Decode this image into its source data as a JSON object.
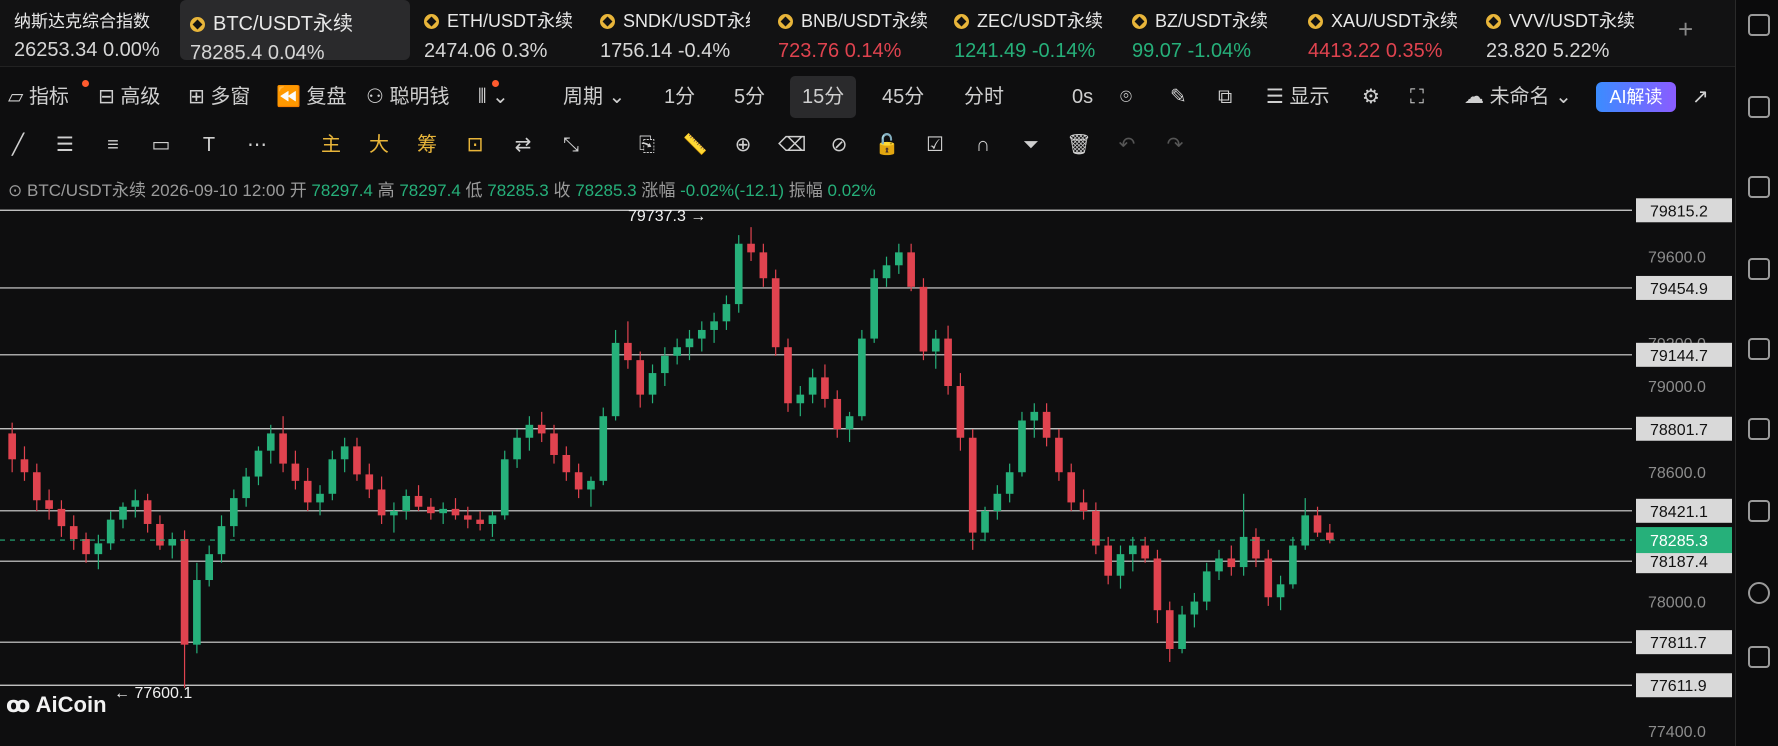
{
  "tickers": [
    {
      "symbol": "纳斯达克综合指数",
      "price": "26253.34",
      "change": "0.00%",
      "color": "#e8e8e8",
      "icon": ""
    },
    {
      "symbol": "BTC/USDT永续",
      "price": "78285.4",
      "change": "0.04%",
      "color": "#e8e8e8",
      "icon": "coin-icon",
      "active": true
    },
    {
      "symbol": "ETH/USDT永续",
      "price": "2474.06",
      "change": "0.3%",
      "color": "#e8e8e8",
      "icon": "coin-icon"
    },
    {
      "symbol": "SNDK/USDT永续",
      "price": "1756.14",
      "change": "-0.4%",
      "color": "#e8e8e8",
      "icon": "coin-icon"
    },
    {
      "symbol": "BNB/USDT永续",
      "price": "723.76",
      "change": "0.14%",
      "color": "#e0434f",
      "icon": "coin-icon"
    },
    {
      "symbol": "ZEC/USDT永续",
      "price": "1241.49",
      "change": "-0.14%",
      "color": "#26b07a",
      "icon": "coin-icon"
    },
    {
      "symbol": "BZ/USDT永续",
      "price": "99.07",
      "change": "-1.04%",
      "color": "#26b07a",
      "icon": "coin-icon"
    },
    {
      "symbol": "XAU/USDT永续",
      "price": "4413.22",
      "change": "0.35%",
      "color": "#e0434f",
      "icon": "coin-icon"
    },
    {
      "symbol": "VVV/USDT永续",
      "price": "23.820",
      "change": "5.22%",
      "color": "#e8e8e8",
      "icon": "coin-icon"
    }
  ],
  "toolbar": {
    "indicator": "指标",
    "advanced": "高级",
    "multi_window": "多窗",
    "replay": "复盘",
    "smart_money": "聪明钱",
    "period": "周期",
    "p1": "1分",
    "p5": "5分",
    "p15": "15分",
    "p45": "45分",
    "timeshare": "分时",
    "countdown": "0s",
    "display": "显示",
    "unnamed": "未命名",
    "ai": "AI解读"
  },
  "drawbar": {
    "main": "主",
    "big": "大",
    "chips": "筹"
  },
  "legend": {
    "symbol": "BTC/USDT永续",
    "time": "2026-09-10 12:00",
    "open_label": "开",
    "open": "78297.4",
    "high_label": "高",
    "high": "78297.4",
    "low_label": "低",
    "low": "78285.3",
    "close_label": "收",
    "close": "78285.3",
    "chg_label": "涨幅",
    "chg": "-0.02%(-12.1)",
    "amp_label": "振幅",
    "amp": "0.02%"
  },
  "logo": "AiCoin",
  "colors": {
    "up": "#26b07a",
    "down": "#e0434f",
    "bg": "#0e0e0f"
  },
  "chart_data": {
    "type": "candlestick",
    "y_axis_ticks": [
      79600.0,
      79200.0,
      79000.0,
      78600.0,
      78000.0,
      77400.0
    ],
    "ylim": [
      77330,
      79900
    ],
    "horizontal_levels": [
      79815.2,
      79454.9,
      79144.7,
      78801.7,
      78421.1,
      78187.4,
      77811.7,
      77611.9
    ],
    "current_price": 78285.3,
    "annotations": [
      {
        "text": "79737.3 →",
        "price": 79737.3
      },
      {
        "text": "← 77600.1",
        "price": 77600.1
      }
    ],
    "candles": [
      [
        78780,
        78830,
        78600,
        78660
      ],
      [
        78660,
        78720,
        78560,
        78600
      ],
      [
        78600,
        78640,
        78420,
        78470
      ],
      [
        78470,
        78520,
        78380,
        78430
      ],
      [
        78430,
        78470,
        78300,
        78350
      ],
      [
        78350,
        78400,
        78240,
        78290
      ],
      [
        78290,
        78320,
        78180,
        78220
      ],
      [
        78220,
        78310,
        78150,
        78270
      ],
      [
        78270,
        78420,
        78240,
        78380
      ],
      [
        78380,
        78460,
        78340,
        78440
      ],
      [
        78440,
        78520,
        78390,
        78470
      ],
      [
        78470,
        78500,
        78320,
        78360
      ],
      [
        78360,
        78400,
        78240,
        78260
      ],
      [
        78260,
        78320,
        78200,
        78290
      ],
      [
        78290,
        78330,
        77600,
        77800
      ],
      [
        77800,
        78180,
        77760,
        78100
      ],
      [
        78100,
        78260,
        78070,
        78220
      ],
      [
        78220,
        78400,
        78180,
        78350
      ],
      [
        78350,
        78520,
        78300,
        78480
      ],
      [
        78480,
        78620,
        78440,
        78580
      ],
      [
        78580,
        78720,
        78540,
        78700
      ],
      [
        78700,
        78820,
        78640,
        78780
      ],
      [
        78780,
        78860,
        78600,
        78640
      ],
      [
        78640,
        78700,
        78520,
        78560
      ],
      [
        78560,
        78620,
        78420,
        78460
      ],
      [
        78460,
        78540,
        78400,
        78500
      ],
      [
        78500,
        78700,
        78470,
        78660
      ],
      [
        78660,
        78760,
        78600,
        78720
      ],
      [
        78720,
        78760,
        78560,
        78590
      ],
      [
        78590,
        78640,
        78480,
        78520
      ],
      [
        78520,
        78580,
        78360,
        78400
      ],
      [
        78400,
        78460,
        78320,
        78420
      ],
      [
        78420,
        78520,
        78380,
        78490
      ],
      [
        78490,
        78540,
        78420,
        78440
      ],
      [
        78440,
        78480,
        78380,
        78410
      ],
      [
        78410,
        78460,
        78360,
        78430
      ],
      [
        78430,
        78480,
        78380,
        78400
      ],
      [
        78400,
        78440,
        78340,
        78380
      ],
      [
        78380,
        78420,
        78330,
        78360
      ],
      [
        78360,
        78420,
        78300,
        78400
      ],
      [
        78400,
        78700,
        78380,
        78660
      ],
      [
        78660,
        78800,
        78620,
        78760
      ],
      [
        78760,
        78860,
        78700,
        78820
      ],
      [
        78820,
        78880,
        78740,
        78780
      ],
      [
        78780,
        78820,
        78640,
        78680
      ],
      [
        78680,
        78720,
        78560,
        78600
      ],
      [
        78600,
        78640,
        78480,
        78520
      ],
      [
        78520,
        78580,
        78440,
        78560
      ],
      [
        78560,
        78900,
        78540,
        78860
      ],
      [
        78860,
        79260,
        78840,
        79200
      ],
      [
        79200,
        79300,
        79080,
        79120
      ],
      [
        79120,
        79160,
        78900,
        78960
      ],
      [
        78960,
        79100,
        78920,
        79060
      ],
      [
        79060,
        79180,
        79000,
        79140
      ],
      [
        79140,
        79220,
        79100,
        79180
      ],
      [
        79180,
        79260,
        79120,
        79220
      ],
      [
        79220,
        79300,
        79160,
        79260
      ],
      [
        79260,
        79340,
        79200,
        79300
      ],
      [
        79300,
        79420,
        79260,
        79380
      ],
      [
        79380,
        79700,
        79340,
        79660
      ],
      [
        79660,
        79737,
        79580,
        79620
      ],
      [
        79620,
        79660,
        79460,
        79500
      ],
      [
        79500,
        79540,
        79140,
        79180
      ],
      [
        79180,
        79220,
        78880,
        78920
      ],
      [
        78920,
        79000,
        78860,
        78960
      ],
      [
        78960,
        79080,
        78920,
        79040
      ],
      [
        79040,
        79100,
        78900,
        78940
      ],
      [
        78940,
        78980,
        78760,
        78800
      ],
      [
        78800,
        78880,
        78740,
        78860
      ],
      [
        78860,
        79260,
        78840,
        79220
      ],
      [
        79220,
        79540,
        79200,
        79500
      ],
      [
        79500,
        79600,
        79460,
        79560
      ],
      [
        79560,
        79660,
        79520,
        79620
      ],
      [
        79620,
        79660,
        79440,
        79460
      ],
      [
        79460,
        79500,
        79120,
        79160
      ],
      [
        79160,
        79260,
        79080,
        79220
      ],
      [
        79220,
        79280,
        78960,
        79000
      ],
      [
        79000,
        79060,
        78700,
        78760
      ],
      [
        78760,
        78800,
        78240,
        78320
      ],
      [
        78320,
        78440,
        78280,
        78420
      ],
      [
        78420,
        78540,
        78380,
        78500
      ],
      [
        78500,
        78640,
        78460,
        78600
      ],
      [
        78600,
        78880,
        78580,
        78840
      ],
      [
        78840,
        78920,
        78760,
        78880
      ],
      [
        78880,
        78920,
        78720,
        78760
      ],
      [
        78760,
        78800,
        78560,
        78600
      ],
      [
        78600,
        78640,
        78420,
        78460
      ],
      [
        78460,
        78520,
        78380,
        78420
      ],
      [
        78420,
        78460,
        78220,
        78260
      ],
      [
        78260,
        78300,
        78080,
        78120
      ],
      [
        78120,
        78260,
        78060,
        78220
      ],
      [
        78220,
        78300,
        78140,
        78260
      ],
      [
        78260,
        78300,
        78180,
        78200
      ],
      [
        78200,
        78240,
        77900,
        77960
      ],
      [
        77960,
        78000,
        77720,
        77780
      ],
      [
        77780,
        77980,
        77760,
        77940
      ],
      [
        77940,
        78040,
        77880,
        78000
      ],
      [
        78000,
        78180,
        77960,
        78140
      ],
      [
        78140,
        78240,
        78100,
        78200
      ],
      [
        78200,
        78260,
        78120,
        78160
      ],
      [
        78160,
        78500,
        78120,
        78300
      ],
      [
        78300,
        78340,
        78160,
        78200
      ],
      [
        78200,
        78240,
        77980,
        78020
      ],
      [
        78020,
        78120,
        77960,
        78080
      ],
      [
        78080,
        78300,
        78060,
        78260
      ],
      [
        78260,
        78480,
        78240,
        78400
      ],
      [
        78400,
        78440,
        78300,
        78320
      ],
      [
        78320,
        78360,
        78270,
        78285
      ]
    ]
  }
}
